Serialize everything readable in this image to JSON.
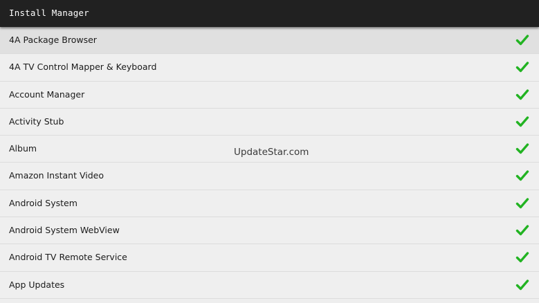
{
  "window": {
    "title": "Install Manager"
  },
  "list": {
    "items": [
      {
        "label": "4A Package Browser",
        "status_icon": "check-icon",
        "selected": true
      },
      {
        "label": "4A TV Control Mapper & Keyboard",
        "status_icon": "check-icon",
        "selected": false
      },
      {
        "label": "Account Manager",
        "status_icon": "check-icon",
        "selected": false
      },
      {
        "label": "Activity Stub",
        "status_icon": "check-icon",
        "selected": false
      },
      {
        "label": "Album",
        "status_icon": "check-icon",
        "selected": false
      },
      {
        "label": "Amazon Instant Video",
        "status_icon": "check-icon",
        "selected": false
      },
      {
        "label": "Android System",
        "status_icon": "check-icon",
        "selected": false
      },
      {
        "label": "Android System WebView",
        "status_icon": "check-icon",
        "selected": false
      },
      {
        "label": "Android TV Remote Service",
        "status_icon": "check-icon",
        "selected": false
      },
      {
        "label": "App Updates",
        "status_icon": "check-icon",
        "selected": false
      }
    ]
  },
  "watermark": {
    "text": "UpdateStar.com"
  },
  "colors": {
    "titlebar_bg": "#212121",
    "list_bg": "#efefef",
    "selected_row_bg": "#e0e0e0",
    "check_green": "#22b322"
  }
}
